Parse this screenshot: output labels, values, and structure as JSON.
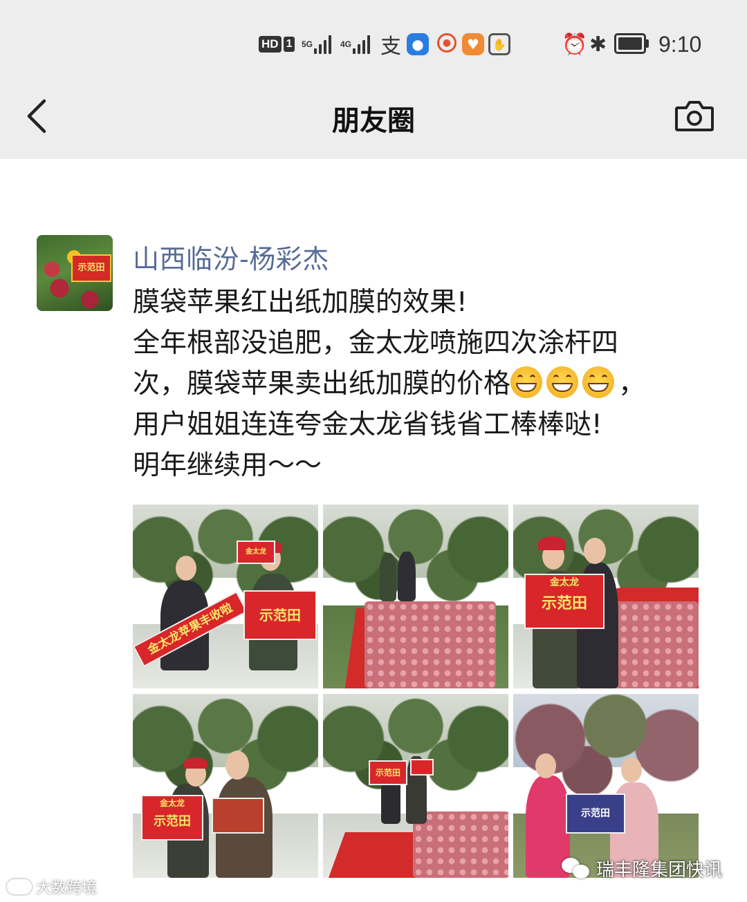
{
  "status_bar": {
    "hd_label": "HD",
    "sim_slot": "1",
    "signal1_label": "5G",
    "signal2_label": "4G",
    "alipay_glyph": "支",
    "time": "9:10",
    "icons": [
      "hd-icon",
      "signal-5g-icon",
      "signal-4g-icon",
      "alipay-icon",
      "bulb-app-icon",
      "cup-app-icon",
      "heart-app-icon",
      "hand-app-icon",
      "alarm-icon",
      "bluetooth-icon",
      "battery-charging-icon"
    ]
  },
  "nav": {
    "title": "朋友圈",
    "back_icon": "chevron-left-icon",
    "camera_icon": "camera-icon"
  },
  "post": {
    "author": "山西临汾-杨彩杰",
    "lines": [
      "膜袋苹果红出纸加膜的效果!",
      "全年根部没追肥，金太龙喷施四次涂杆四",
      "次，膜袋苹果卖出纸加膜的价格",
      "用户姐姐连连夸金太龙省钱省工棒棒哒!",
      "明年继续用～～"
    ],
    "line3_suffix": "，",
    "emoji_name": "grinning-face-emoji",
    "emoji_count": 3,
    "avatar_sign": "示范田",
    "photos": [
      {
        "name": "photo-1",
        "banner_text": "金太龙苹果丰收啦",
        "sign_text": "示范田",
        "sign_header": "金太龙"
      },
      {
        "name": "photo-2"
      },
      {
        "name": "photo-3",
        "sign_header": "金太龙",
        "sign_text": "示范田"
      },
      {
        "name": "photo-4",
        "sign_header": "金太龙",
        "sign_text": "示范田"
      },
      {
        "name": "photo-5",
        "sign_text": "示范田"
      },
      {
        "name": "photo-6",
        "sign_text": "示范田"
      }
    ]
  },
  "watermarks": {
    "left": "大数跨境",
    "right": "瑞丰隆集团快讯"
  },
  "colors": {
    "status_bg": "#ededed",
    "author_link": "#576b95",
    "text": "#191919"
  }
}
